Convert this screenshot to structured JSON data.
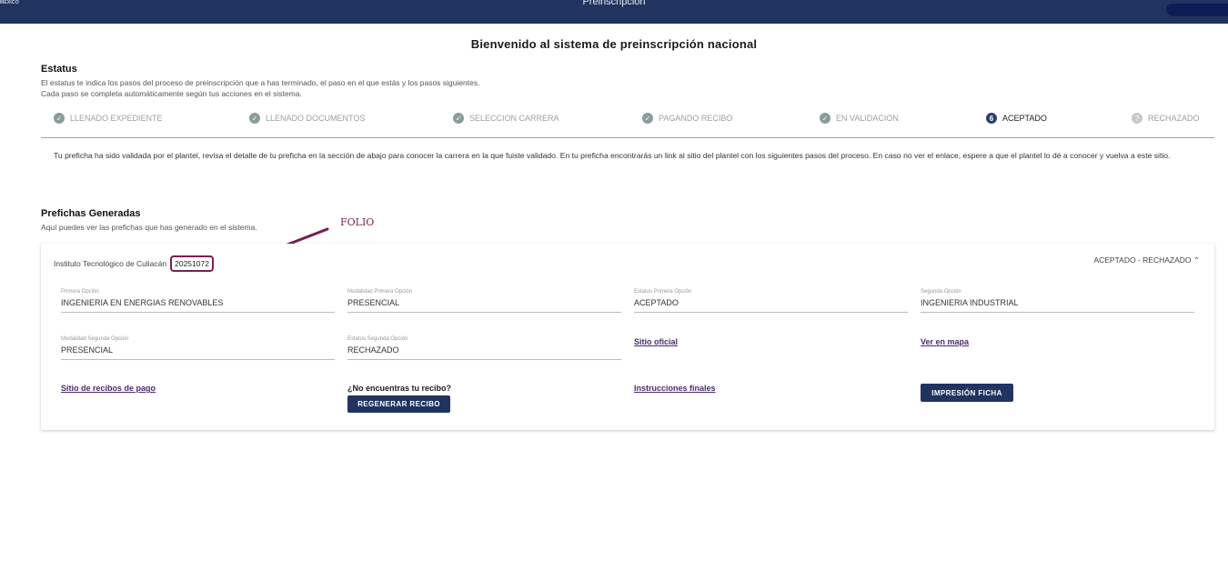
{
  "header": {
    "logo_text": "MÉXICO",
    "title": "Preinscripción"
  },
  "welcome": "Bienvenido al sistema de preinscripción nacional",
  "status": {
    "title": "Estatus",
    "desc_line1": "El estatus te indica los pasos del proceso de preinscripción que a has terminado, el paso en el que estás y los pasos siguientes.",
    "desc_line2": "Cada paso se completa automáticamente según tus acciones en el sistema.",
    "steps": [
      {
        "label": "LLENADO EXPEDIENTE",
        "state": "done",
        "icon": "check-icon"
      },
      {
        "label": "LLENADO DOCUMENTOS",
        "state": "done",
        "icon": "check-icon"
      },
      {
        "label": "SELECCION CARRERA",
        "state": "done",
        "icon": "check-icon"
      },
      {
        "label": "PAGANDO RECIBO",
        "state": "done",
        "icon": "check-icon"
      },
      {
        "label": "EN VALIDACION",
        "state": "done",
        "icon": "check-icon"
      },
      {
        "label": "ACEPTADO",
        "state": "active",
        "number": "6"
      },
      {
        "label": "RECHAZADO",
        "state": "pending",
        "icon": "question-icon",
        "symbol": "?"
      }
    ]
  },
  "notice": "Tu preficha ha sido validada por el plantel, revisa el detalle de tu preficha en la sección de abajo para conocer la carrera en la que fuiste validado. En tu preficha encontrarás un link al sitio del plantel con los siguientes pasos del proceso. En caso no ver el enlace, espere a que el plantel lo dé a conocer y vuelva a este sitio.",
  "prefichas": {
    "title": "Prefichas Generadas",
    "subtitle": "Aquí puedes ver las prefichas que has generado en el sistema.",
    "annotation": "FOLIO",
    "card": {
      "institution": "Instituto Tecnológico de Culiacán",
      "folio": "20251072",
      "status_header": "ACEPTADO - RECHAZADO",
      "fields": {
        "primera_opcion": {
          "label": "Primera Opción",
          "value": "INGENIERIA EN ENERGIAS RENOVABLES"
        },
        "modalidad_primera": {
          "label": "Modalidad Primera Opción",
          "value": "PRESENCIAL"
        },
        "estatus_primera": {
          "label": "Estatus Primera Opción",
          "value": "ACEPTADO"
        },
        "segunda_opcion": {
          "label": "Segunda Opción",
          "value": "INGENIERIA INDUSTRIAL"
        },
        "modalidad_segunda": {
          "label": "Modalidad Segunda Opción",
          "value": "PRESENCIAL"
        },
        "estatus_segunda": {
          "label": "Estatus Segunda Opción",
          "value": "RECHAZADO"
        }
      },
      "links": {
        "sitio_oficial": "Sitio oficial",
        "ver_mapa": "Ver en mapa",
        "sitio_recibos": "Sitio de recibos de pago",
        "instrucciones": "Instrucciones finales"
      },
      "question": "¿No encuentras tu recibo?",
      "buttons": {
        "regenerar": "REGENERAR RECIBO",
        "impresion": "IMPRESIÓN FICHA"
      }
    }
  },
  "colors": {
    "header_bg": "#20345f",
    "accent": "#2c3f6b",
    "annotation": "#7a1e52",
    "done_step": "#8a9c9c"
  }
}
